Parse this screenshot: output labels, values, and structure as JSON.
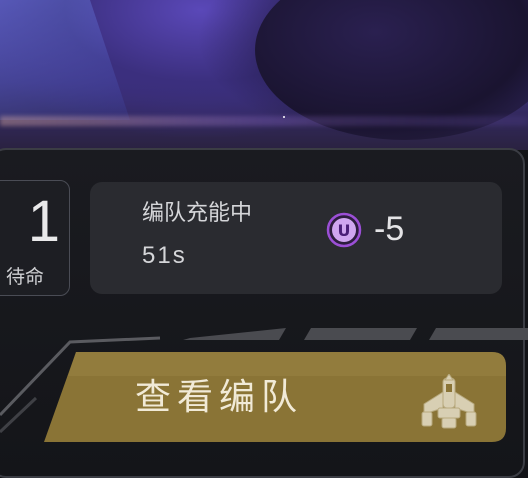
{
  "squad_count": {
    "value": "1",
    "label": "待命"
  },
  "charge_panel": {
    "status": "编队充能中",
    "remaining_time": "51s",
    "currency_icon": "U",
    "cost": "-5"
  },
  "view_button": {
    "label": "查看编队"
  },
  "icons": {
    "currency": "u-coin-icon",
    "ship": "starship-icon"
  },
  "colors": {
    "button_gold": "#8a7436",
    "currency_purple": "#9b4fd6",
    "panel_bg": "#1a1b20",
    "card_bg": "#2a2b30"
  }
}
